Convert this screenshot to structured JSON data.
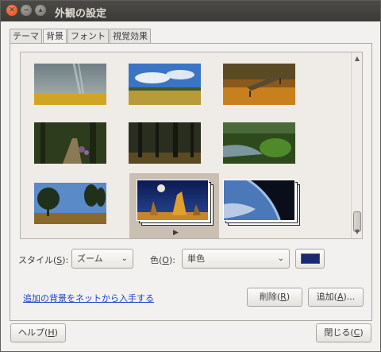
{
  "window": {
    "title": "外観の設定"
  },
  "titlebar_buttons": {
    "close_glyph": "✕",
    "minimize_glyph": "‒",
    "maximize_glyph": "▴"
  },
  "tabs": [
    {
      "label": "テーマ"
    },
    {
      "label": "背景"
    },
    {
      "label": "フォント"
    },
    {
      "label": "視覚効果"
    }
  ],
  "active_tab": "背景",
  "gallery": {
    "wallpapers": [
      {
        "name": "rainbow-field",
        "scene": "rainy sky over golden field"
      },
      {
        "name": "blue-sky-meadow",
        "scene": "blue sky with clouds over green meadow"
      },
      {
        "name": "autumn-bench",
        "scene": "wooden bench among autumn leaves"
      },
      {
        "name": "forest-path",
        "scene": "path through dark green forest"
      },
      {
        "name": "dark-woods",
        "scene": "tall dark tree trunks"
      },
      {
        "name": "river-fern",
        "scene": "stream with green plants"
      },
      {
        "name": "tree-silhouettes",
        "scene": "trees against blue sky"
      },
      {
        "name": "pinnacles-moon",
        "scene": "rock spires under night sky with moon",
        "selected": true
      },
      {
        "name": "earth-from-space",
        "scene": "planet limb in space"
      }
    ],
    "play_glyph": "▶"
  },
  "style": {
    "label": "スタイル(",
    "mnemonic": "S",
    "label_end": "):",
    "value": "ズーム"
  },
  "color": {
    "label": "色(",
    "mnemonic": "O",
    "label_end": "):",
    "value": "単色",
    "swatch": "#1a2a6b"
  },
  "links": {
    "get_more": "追加の背景をネットから入手する"
  },
  "buttons": {
    "remove": {
      "text": "削除(",
      "mnemonic": "R",
      "end": ")"
    },
    "add": {
      "text": "追加(",
      "mnemonic": "A",
      "end": ")..."
    },
    "help": {
      "text": "ヘルプ(",
      "mnemonic": "H",
      "end": ")"
    },
    "close": {
      "text": "閉じる(",
      "mnemonic": "C",
      "end": ")"
    }
  },
  "colors": {
    "link": "#1c44c9",
    "titlebar": "#3c3b37",
    "selection": "#c9bfb3"
  }
}
